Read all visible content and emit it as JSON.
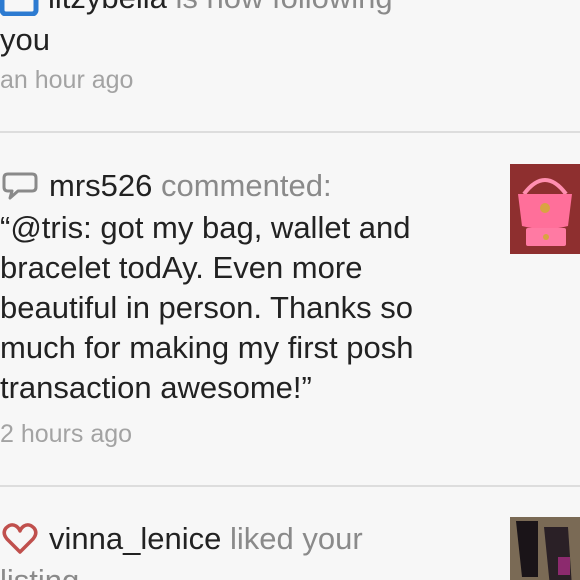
{
  "feed": {
    "items": [
      {
        "icon": "user-icon",
        "username": "litzybella",
        "action": " is now following",
        "text_lines": [
          "you"
        ],
        "time": "an hour ago"
      },
      {
        "icon": "comment-icon",
        "username": "mrs526",
        "action": " commented:",
        "text_lines": [
          "“@tris: got my bag, wallet and",
          "bracelet todAy. Even more",
          "beautiful in person. Thanks so",
          "much for making my first posh",
          "transaction awesome!”"
        ],
        "time": "2 hours ago",
        "thumbnail": "pink-handbag-and-wallet"
      },
      {
        "icon": "heart-icon",
        "username": "vinna_lenice",
        "action": " liked your",
        "text_lines": [
          "listing"
        ],
        "thumbnail": "black-boots"
      }
    ]
  },
  "colors": {
    "background": "#f7f7f7",
    "text": "#222222",
    "muted": "#8a8a8a",
    "timestamp": "#a3a3a3",
    "divider": "#dddddd",
    "heart": "#c0504d",
    "user_icon": "#2d7bd1"
  }
}
